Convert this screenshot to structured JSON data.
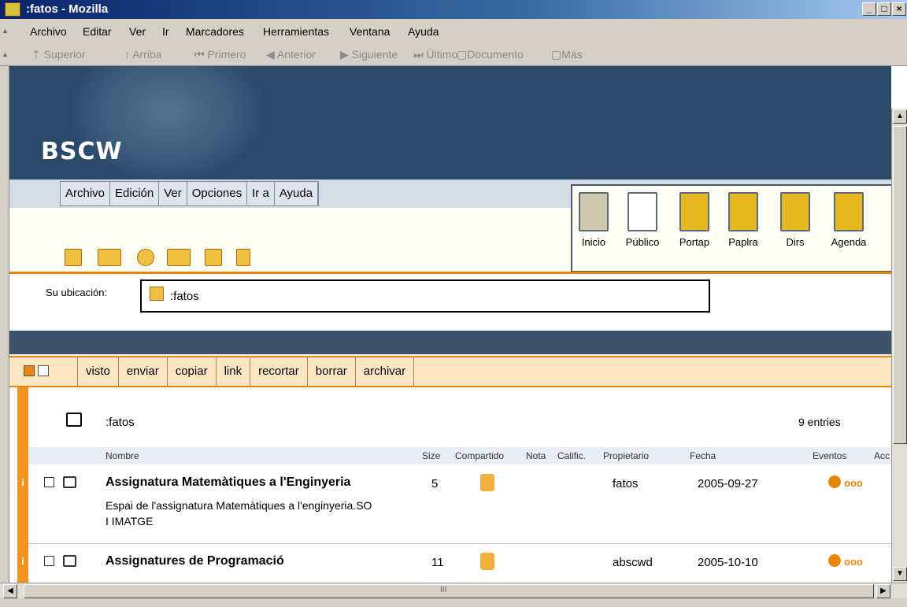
{
  "window": {
    "title": ":fatos - Mozilla",
    "buttons": [
      "_",
      "□",
      "×"
    ]
  },
  "browser_menu": [
    "Archivo",
    "Editar",
    "Ver",
    "Ir",
    "Marcadores",
    "Herramientas",
    "Ventana",
    "Ayuda"
  ],
  "nav": [
    "Superior",
    "Arriba",
    "Primero",
    "Anterior",
    "Siguiente",
    "Último",
    "Documento",
    "Más"
  ],
  "app": {
    "brand": "BSCW",
    "menu": [
      "Archivo",
      "Edición",
      "Ver",
      "Opciones",
      "Ir a",
      "Ayuda"
    ],
    "big_icons": [
      "Inicio",
      "Público",
      "Portap",
      "Paplra",
      "Dirs",
      "Agenda"
    ],
    "location_label": "Su ubicación:",
    "location_value": ":fatos",
    "actions": [
      "visto",
      "enviar",
      "copiar",
      "link",
      "recortar",
      "borrar",
      "archivar"
    ],
    "folder": {
      "name": ":fatos",
      "count": "9 entries"
    },
    "columns": [
      "Nombre",
      "Size",
      "Compartido",
      "Nota",
      "Calific.",
      "Propietario",
      "Fecha",
      "Eventos",
      "Acc"
    ],
    "rows": [
      {
        "info": "i",
        "name": "Assignatura Matemàtiques a l'Enginyeria",
        "desc": "Espai de l'assignatura Matemàtiques a l'enginyeria.SO I IMATGE",
        "size": "5",
        "owner": "fatos",
        "date": "2005-09-27",
        "events": "ooo"
      },
      {
        "info": "i",
        "name": "Assignatures de Programació",
        "desc": "",
        "size": "11",
        "owner": "abscwd",
        "date": "2005-10-10",
        "events": "ooo"
      }
    ]
  },
  "scroll_grip": "III"
}
